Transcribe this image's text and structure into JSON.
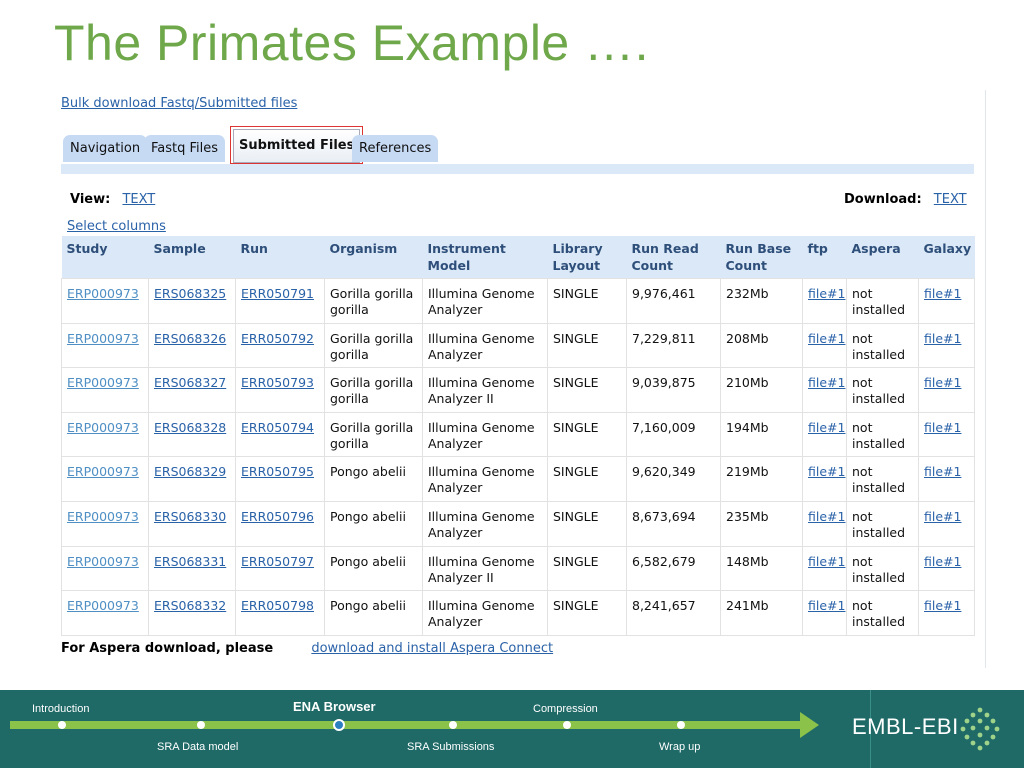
{
  "slide": {
    "title": "The Primates Example …."
  },
  "bulk_link": "Bulk download Fastq/Submitted files",
  "tabs": [
    "Navigation",
    "Fastq Files",
    "Submitted Files",
    "References"
  ],
  "view": {
    "label": "View:",
    "link": "TEXT"
  },
  "download": {
    "label": "Download:",
    "link": "TEXT"
  },
  "select_columns": "Select columns",
  "columns": [
    "Study",
    "Sample",
    "Run",
    "Organism",
    "Instrument Model",
    "Library Layout",
    "Run Read Count",
    "Run Base Count",
    "ftp",
    "Aspera",
    "Galaxy"
  ],
  "rows": [
    {
      "study": "ERP000973",
      "sample": "ERS068325",
      "run": "ERR050791",
      "organism": "Gorilla gorilla gorilla",
      "instrument": "Illumina Genome Analyzer",
      "layout": "SINGLE",
      "reads": "9,976,461",
      "bases": "232Mb",
      "ftp": "file#1",
      "aspera": "not installed",
      "galaxy": "file#1"
    },
    {
      "study": "ERP000973",
      "sample": "ERS068326",
      "run": "ERR050792",
      "organism": "Gorilla gorilla gorilla",
      "instrument": "Illumina Genome Analyzer",
      "layout": "SINGLE",
      "reads": "7,229,811",
      "bases": "208Mb",
      "ftp": "file#1",
      "aspera": "not installed",
      "galaxy": "file#1"
    },
    {
      "study": "ERP000973",
      "sample": "ERS068327",
      "run": "ERR050793",
      "organism": "Gorilla gorilla gorilla",
      "instrument": "Illumina Genome Analyzer II",
      "layout": "SINGLE",
      "reads": "9,039,875",
      "bases": "210Mb",
      "ftp": "file#1",
      "aspera": "not installed",
      "galaxy": "file#1"
    },
    {
      "study": "ERP000973",
      "sample": "ERS068328",
      "run": "ERR050794",
      "organism": "Gorilla gorilla gorilla",
      "instrument": "Illumina Genome Analyzer",
      "layout": "SINGLE",
      "reads": "7,160,009",
      "bases": "194Mb",
      "ftp": "file#1",
      "aspera": "not installed",
      "galaxy": "file#1"
    },
    {
      "study": "ERP000973",
      "sample": "ERS068329",
      "run": "ERR050795",
      "organism": "Pongo abelii",
      "instrument": "Illumina Genome Analyzer",
      "layout": "SINGLE",
      "reads": "9,620,349",
      "bases": "219Mb",
      "ftp": "file#1",
      "aspera": "not installed",
      "galaxy": "file#1"
    },
    {
      "study": "ERP000973",
      "sample": "ERS068330",
      "run": "ERR050796",
      "organism": "Pongo abelii",
      "instrument": "Illumina Genome Analyzer",
      "layout": "SINGLE",
      "reads": "8,673,694",
      "bases": "235Mb",
      "ftp": "file#1",
      "aspera": "not installed",
      "galaxy": "file#1"
    },
    {
      "study": "ERP000973",
      "sample": "ERS068331",
      "run": "ERR050797",
      "organism": "Pongo abelii",
      "instrument": "Illumina Genome Analyzer II",
      "layout": "SINGLE",
      "reads": "6,582,679",
      "bases": "148Mb",
      "ftp": "file#1",
      "aspera": "not installed",
      "galaxy": "file#1"
    },
    {
      "study": "ERP000973",
      "sample": "ERS068332",
      "run": "ERR050798",
      "organism": "Pongo abelii",
      "instrument": "Illumina Genome Analyzer",
      "layout": "SINGLE",
      "reads": "8,241,657",
      "bases": "241Mb",
      "ftp": "file#1",
      "aspera": "not installed",
      "galaxy": "file#1"
    }
  ],
  "aspera": {
    "label": "For Aspera download, please",
    "link": "download and install Aspera Connect"
  },
  "footer": {
    "nav_top": [
      "Introduction",
      "ENA Browser",
      "Compression"
    ],
    "nav_bottom": [
      "SRA Data model",
      "SRA Submissions",
      "Wrap up"
    ],
    "current": "ENA Browser",
    "brand": "EMBL-EBI",
    "colors": {
      "background": "#1f6a67",
      "track": "#8bc34a",
      "title": "#6fa84a"
    }
  }
}
